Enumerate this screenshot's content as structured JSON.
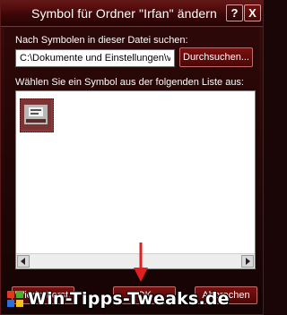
{
  "window": {
    "title": "Symbol für Ordner \"Irfan\" ändern",
    "help_label": "?",
    "close_label": "X"
  },
  "dialog": {
    "search_label": "Nach Symbolen in dieser Datei suchen:",
    "path_value": "C:\\Dokumente und Einstellungen\\v",
    "browse_label": "Durchsuchen...",
    "list_label": "Wählen Sie ein Symbol aus der folgenden Liste aus:"
  },
  "buttons": {
    "restore_label": "Wiederherst.",
    "ok_label": "OK",
    "cancel_label": "Abbrechen"
  },
  "watermark": {
    "text": "Win-Tipps-Tweaks.de"
  },
  "colors": {
    "titlebar": "#3c0707",
    "button": "#6a1010",
    "annotation_arrow": "#e02020"
  }
}
